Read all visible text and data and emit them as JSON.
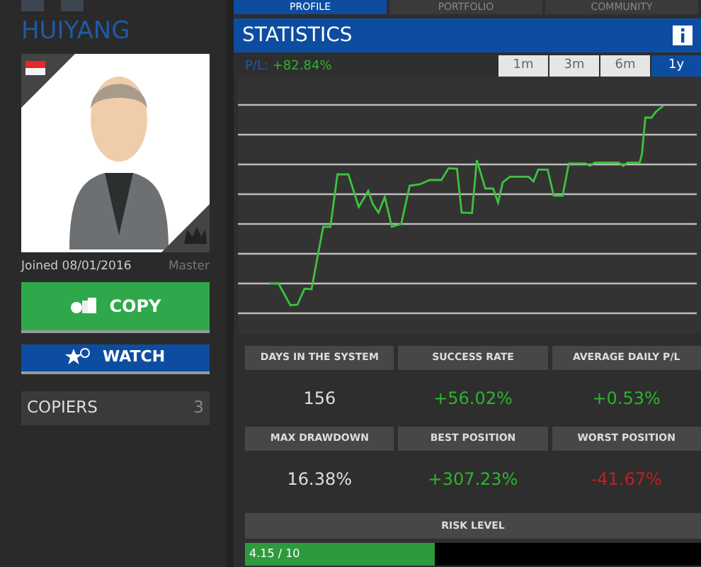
{
  "nav_tabs": [
    {
      "label": "PROFILE",
      "selected": true
    },
    {
      "label": "PORTFOLIO",
      "selected": false
    },
    {
      "label": "COMMUNITY",
      "selected": false
    }
  ],
  "profile": {
    "name": "HUIYANG",
    "joined": "Joined 08/01/2016",
    "rank": "Master"
  },
  "buttons": [
    {
      "kind": "copy",
      "label": "COPY"
    },
    {
      "kind": "watch",
      "label": "WATCH"
    }
  ],
  "copiers": {
    "label": "COPIERS",
    "count": "3"
  },
  "statistics": {
    "title": "STATISTICS",
    "pl_label": "P/L:",
    "pl_value": "+82.84%",
    "ranges": [
      {
        "label": "1m",
        "selected": false
      },
      {
        "label": "3m",
        "selected": false
      },
      {
        "label": "6m",
        "selected": false
      },
      {
        "label": "1y",
        "selected": true
      }
    ],
    "metrics": [
      {
        "label": "DAYS IN THE SYSTEM",
        "value": "156",
        "color": "#dddddd"
      },
      {
        "label": "SUCCESS RATE",
        "value": "+56.02%",
        "color": "#2bb52b"
      },
      {
        "label": "AVERAGE DAILY P/L",
        "value": "+0.53%",
        "color": "#2bb52b"
      },
      {
        "label": "MAX DRAWDOWN",
        "value": "16.38%",
        "color": "#dddddd"
      },
      {
        "label": "BEST POSITION",
        "value": "+307.23%",
        "color": "#2bb52b"
      },
      {
        "label": "WORST POSITION",
        "value": "-41.67%",
        "color": "#c02020"
      }
    ],
    "risk": {
      "label": "RISK LEVEL",
      "reading": "4.15 / 10",
      "level": 0.415
    }
  }
}
